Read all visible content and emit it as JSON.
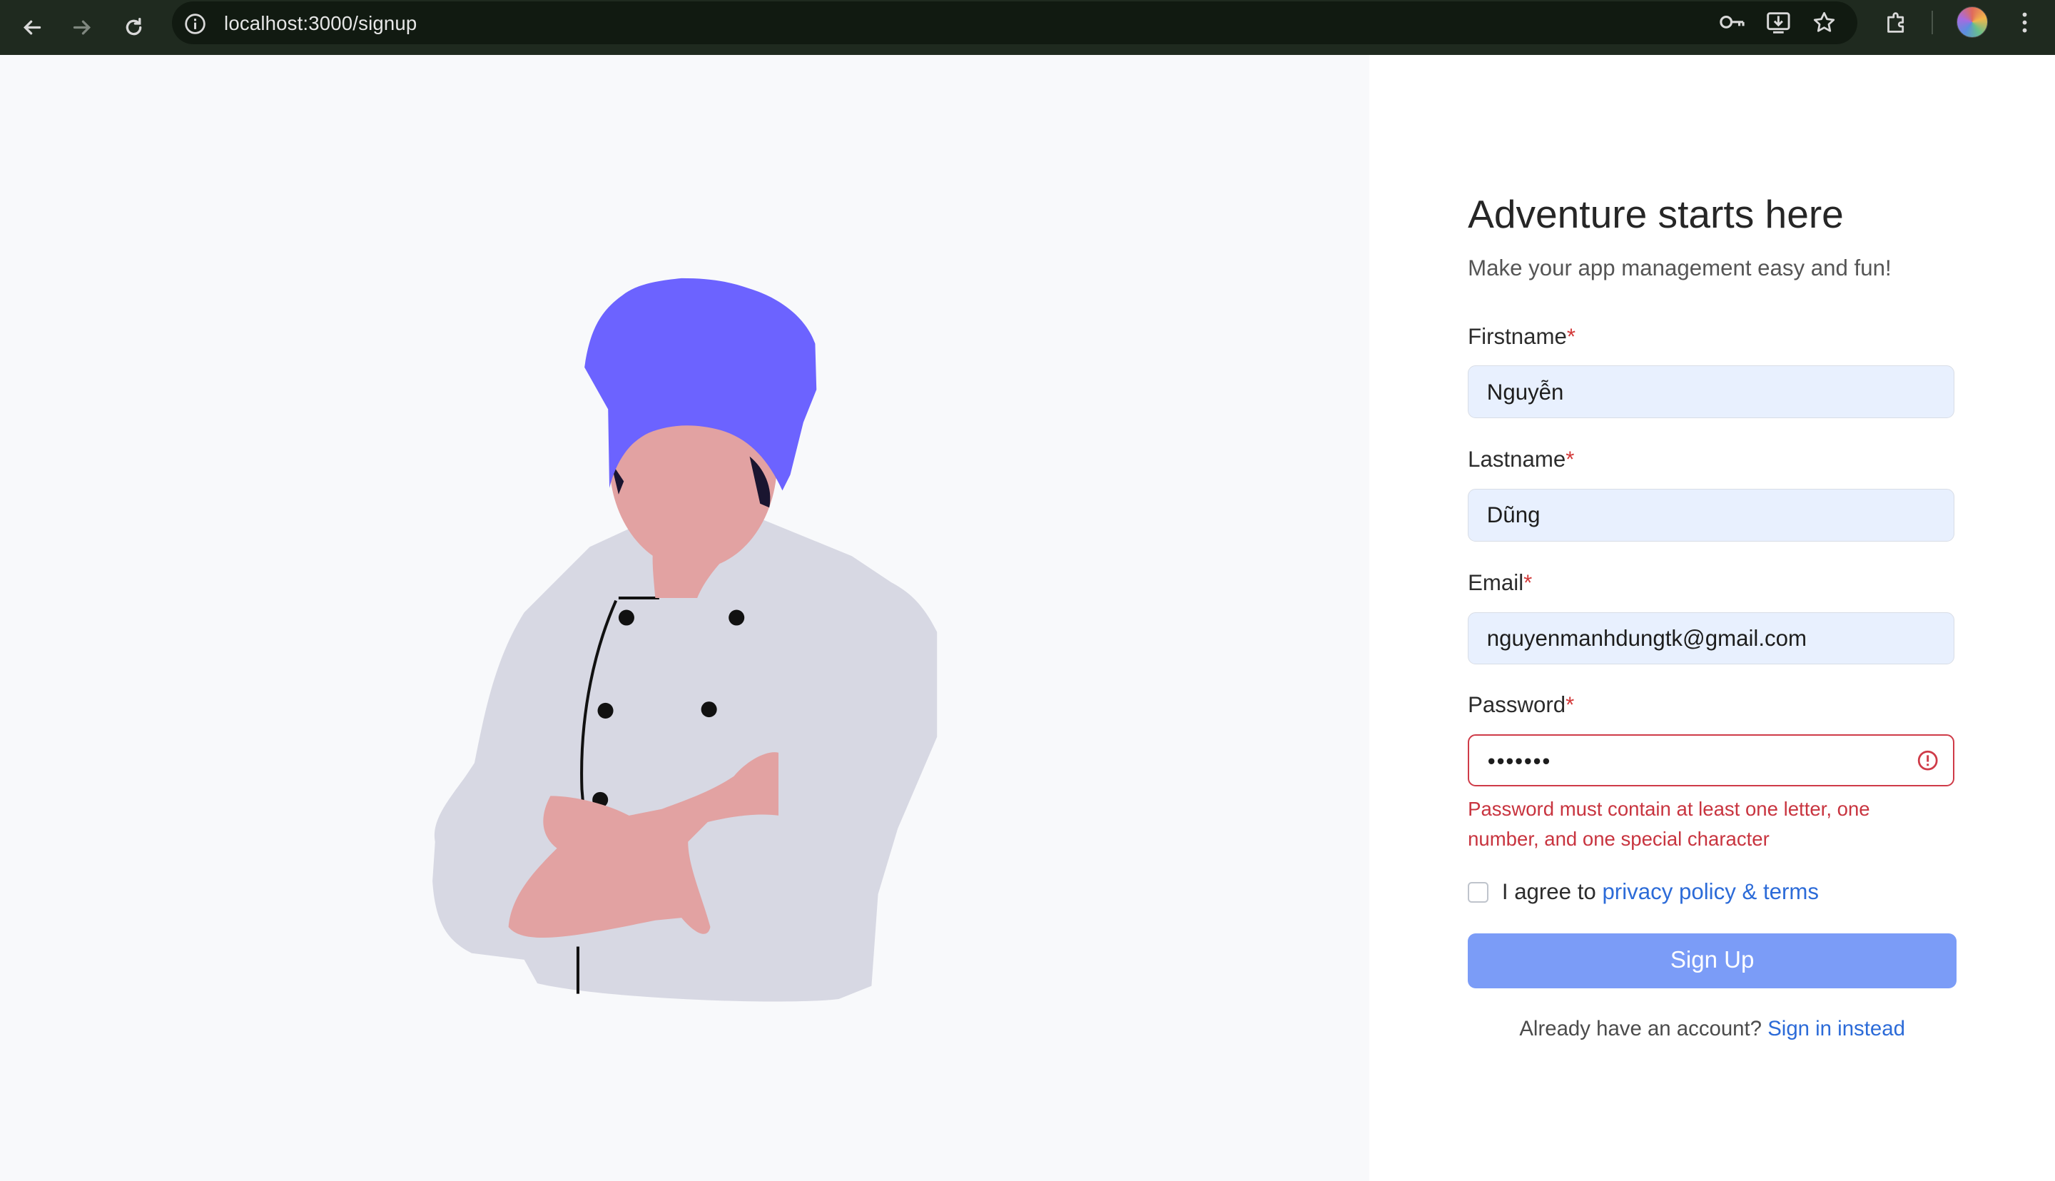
{
  "browser": {
    "url": "localhost:3000/signup",
    "icons": [
      "back-icon",
      "forward-icon",
      "reload-icon",
      "site-info-icon",
      "password-key-icon",
      "install-app-icon",
      "bookmark-star-icon",
      "extensions-icon",
      "profile-avatar",
      "menu-icon"
    ]
  },
  "form": {
    "title": "Adventure starts here",
    "subtitle": "Make your app management easy and fun!",
    "required_mark": "*",
    "fields": {
      "firstname": {
        "label": "Firstname",
        "value": "Nguyễn"
      },
      "lastname": {
        "label": "Lastname",
        "value": "Dũng"
      },
      "email": {
        "label": "Email",
        "value": "nguyenmanhdungtk@gmail.com"
      },
      "password": {
        "label": "Password",
        "value": "•••••••",
        "error": "Password must contain at least one letter, one number, and one special character"
      }
    },
    "agree_prefix": "I agree to",
    "agree_link": "privacy policy & terms",
    "agree_checked": false,
    "submit_label": "Sign Up",
    "signin_prompt": "Already have an account?",
    "signin_link": "Sign in instead"
  },
  "colors": {
    "accent": "#7b9cf7",
    "link": "#2c6bd8",
    "error": "#cf3b48",
    "autofill_bg": "#e8f0fe",
    "chef_hat": "#6c63ff",
    "skin": "#e2a2a2",
    "coat": "#d7d8e3"
  }
}
